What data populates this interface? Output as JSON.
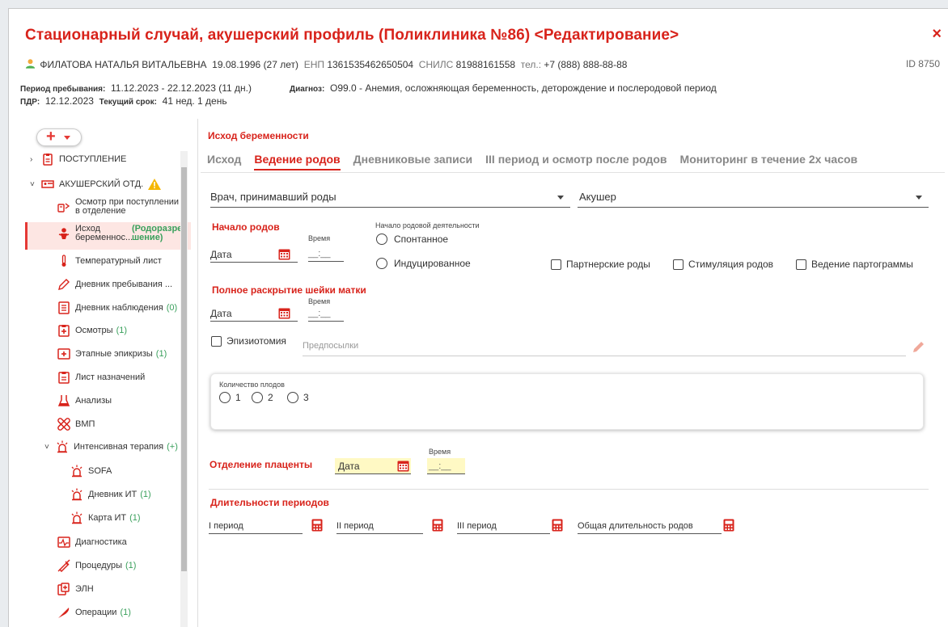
{
  "window": {
    "title": "Стационарный случай, акушерский профиль (Поликлиника №86) <Редактирование>",
    "close_label": "×"
  },
  "patient": {
    "name": "ФИЛАТОВА НАТАЛЬЯ ВИТАЛЬЕВНА",
    "dob": "19.08.1996 (27 лет)",
    "enp_label": "ЕНП",
    "enp": "1361535462650504",
    "snils_label": "СНИЛС",
    "snils": "81988161558",
    "phone_label": "тел.:",
    "phone": "+7 (888) 888-88-88",
    "id": "ID 8750"
  },
  "meta": {
    "period_label": "Период пребывания:",
    "period": "11.12.2023 - 22.12.2023 (11 дн.)",
    "diag_label": "Диагноз:",
    "diag": "O99.0 - Анемия, осложняющая беременность, деторождение и послеродовой период",
    "pdr_label": "ПДР:",
    "pdr": "12.12.2023",
    "term_label": "Текущий срок:",
    "term": "41 нед. 1 день"
  },
  "sidebar": {
    "add_label": "+",
    "items": [
      {
        "label": "ПОСТУПЛЕНИЕ",
        "count": ""
      },
      {
        "label": "АКУШЕРСКИЙ ОТД.",
        "count": ""
      },
      {
        "label": "Осмотр при поступлении",
        "label2": "в отделение",
        "count": ""
      },
      {
        "label": "Исход",
        "label2": "беременнос...",
        "count": "(Родоразре",
        "count2": "шение)"
      },
      {
        "label": "Температурный лист",
        "count": ""
      },
      {
        "label": "Дневник пребывания ...",
        "count": ""
      },
      {
        "label": "Дневник наблюдения",
        "count": "(0)"
      },
      {
        "label": "Осмотры",
        "count": "(1)"
      },
      {
        "label": "Этапные эпикризы",
        "count": "(1)"
      },
      {
        "label": "Лист назначений",
        "count": ""
      },
      {
        "label": "Анализы",
        "count": ""
      },
      {
        "label": "ВМП",
        "count": ""
      },
      {
        "label": "Интенсивная терапия",
        "count": "(+)"
      },
      {
        "label": "SOFA",
        "count": ""
      },
      {
        "label": "Дневник ИТ",
        "count": "(1)"
      },
      {
        "label": "Карта ИТ",
        "count": "(1)"
      },
      {
        "label": "Диагностика",
        "count": ""
      },
      {
        "label": "Процедуры",
        "count": "(1)"
      },
      {
        "label": "ЭЛН",
        "count": ""
      },
      {
        "label": "Операции",
        "count": "(1)"
      }
    ]
  },
  "main": {
    "section_title": "Исход беременности",
    "tabs": [
      {
        "label": "Исход"
      },
      {
        "label": "Ведение родов"
      },
      {
        "label": "Дневниковые записи"
      },
      {
        "label": "III период и осмотр после родов"
      },
      {
        "label": "Мониторинг в течение 2х часов"
      }
    ],
    "doctor_select": "Врач, принимавший роды",
    "obstetrician_select": "Акушер",
    "labor_start": {
      "heading": "Начало родов",
      "date_label": "Дата",
      "time_label": "Время",
      "time_placeholder": "__:__",
      "activity_label": "Начало родовой деятельности",
      "radio_spont": "Спонтанное",
      "radio_induced": "Индуцированное"
    },
    "checks": {
      "partner": "Партнерские роды",
      "stimulation": "Стимуляция родов",
      "partogram": "Ведение партограммы"
    },
    "dilation": {
      "heading": "Полное раскрытие шейки матки",
      "date_label": "Дата",
      "time_label": "Время",
      "time_placeholder": "__:__"
    },
    "episiotomy": {
      "label": "Эпизиотомия",
      "placeholder": "Предпосылки"
    },
    "fetus": {
      "label": "Количество плодов",
      "options": [
        "1",
        "2",
        "3"
      ]
    },
    "placenta": {
      "heading": "Отделение плаценты",
      "date_label": "Дата",
      "time_label": "Время",
      "time_placeholder": "__:__"
    },
    "durations": {
      "heading": "Длительности периодов",
      "p1": "I период",
      "p2": "II период",
      "p3": "III период",
      "total": "Общая длительность родов"
    }
  },
  "colors": {
    "accent": "#d8231b",
    "count": "#3aa05c",
    "active_bg": "#fde6e3",
    "field_yellow": "#fff9c4"
  }
}
